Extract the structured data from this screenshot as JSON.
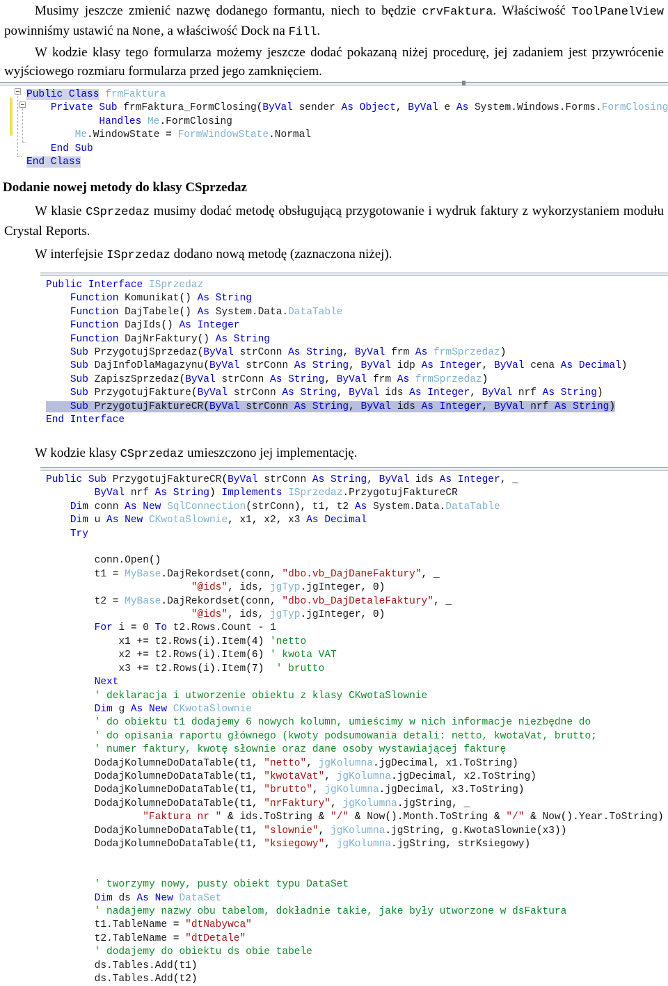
{
  "document": {
    "language": "pl",
    "colors": {
      "keyword": "#0000c8",
      "type": "#7fb2d0",
      "string": "#a31515",
      "comment": "#128a2c",
      "selection": "#b8bedd",
      "changebar": "#f0e050"
    }
  },
  "paragraphs": {
    "p1_part1": "Musimy jeszcze zmienić nazwę dodanego formantu, niech to będzie ",
    "p1_mono1": "crvFaktura",
    "p1_part2": ". Właściwość ",
    "p1_mono2": "ToolPanelView",
    "p1_part3": " powinniśmy ustawić na ",
    "p1_mono3": "None",
    "p1_part4": ", a właściwość Dock na ",
    "p1_mono4": "Fill",
    "p1_part5": ".",
    "p2": "W kodzie klasy tego formularza możemy jeszcze dodać pokazaną niżej procedurę, jej zadaniem jest przywrócenie wyjściowego rozmiaru formularza przed jego zamknięciem.",
    "heading1": "Dodanie nowej metody do klasy CSprzedaz",
    "p3_part1": "W klasie ",
    "p3_mono1": "CSprzedaz",
    "p3_part2": " musimy dodać metodę obsługującą przygotowanie i wydruk faktury z wykorzystaniem modułu Crystal Reports.",
    "p4_part1": "W interfejsie ",
    "p4_mono1": "ISprzedaz",
    "p4_part2": " dodano nową metodę (zaznaczona niżej).",
    "p5_part1": "W kodzie klasy ",
    "p5_mono1": "CSprzedaz",
    "p5_part2": " umieszczono jej implementację."
  },
  "code_block_1": {
    "name": "frmFaktura class code",
    "lines": [
      "Public Class frmFaktura",
      "    Private Sub frmFaktura_FormClosing(ByVal sender As Object, ByVal e As System.Windows.Forms.FormClosingEventArgs) _",
      "            Handles Me.FormClosing",
      "        Me.WindowState = FormWindowState.Normal",
      "    End Sub",
      "End Class"
    ]
  },
  "code_block_2": {
    "name": "ISprzedaz interface",
    "lines": [
      "Public Interface ISprzedaz",
      "    Function Komunikat() As String",
      "    Function DajTabele() As System.Data.DataTable",
      "    Function DajIds() As Integer",
      "    Function DajNrFaktury() As String",
      "    Sub PrzygotujSprzedaz(ByVal strConn As String, ByVal frm As frmSprzedaz)",
      "    Sub DajInfoDlaMagazynu(ByVal strConn As String, ByVal idp As Integer, ByVal cena As Decimal)",
      "    Sub ZapiszSprzedaz(ByVal strConn As String, ByVal frm As frmSprzedaz)",
      "    Sub PrzygotujFakture(ByVal strConn As String, ByVal ids As Integer, ByVal nrf As String)",
      "    Sub PrzygotujFaktureCR(ByVal strConn As String, ByVal ids As Integer, ByVal nrf As String)",
      "End Interface"
    ],
    "selected_line_index": 9
  },
  "code_block_3": {
    "name": "PrzygotujFaktureCR implementation",
    "lines": [
      "Public Sub PrzygotujFaktureCR(ByVal strConn As String, ByVal ids As Integer, _",
      "        ByVal nrf As String) Implements ISprzedaz.PrzygotujFaktureCR",
      "    Dim conn As New SqlConnection(strConn), t1, t2 As System.Data.DataTable",
      "    Dim u As New CKwotaSlownie, x1, x2, x3 As Decimal",
      "    Try",
      "        conn.Open()",
      "        t1 = MyBase.DajRekordset(conn, \"dbo.vb_DajDaneFaktury\", _",
      "                        \"@ids\", ids, jgTyp.jgInteger, 0)",
      "        t2 = MyBase.DajRekordset(conn, \"dbo.vb_DajDetaleFaktury\", _",
      "                        \"@ids\", ids, jgTyp.jgInteger, 0)",
      "        For i = 0 To t2.Rows.Count - 1",
      "            x1 += t2.Rows(i).Item(4) 'netto",
      "            x2 += t2.Rows(i).Item(6) ' kwota VAT",
      "            x3 += t2.Rows(i).Item(7)  ' brutto",
      "        Next",
      "        ' deklaracja i utworzenie obiektu z klasy CKwotaSlownie",
      "        Dim g As New CKwotaSlownie",
      "        ' do obiektu t1 dodajemy 6 nowych kolumn, umieścimy w nich informacje niezbędne do",
      "        ' do opisania raportu głównego (kwoty podsumowania detali: netto, kwotaVat, brutto;",
      "        ' numer faktury, kwotę słownie oraz dane osoby wystawiającej fakturę",
      "        DodajKolumneDoDataTable(t1, \"netto\", jgKolumna.jgDecimal, x1.ToString)",
      "        DodajKolumneDoDataTable(t1, \"kwotaVat\", jgKolumna.jgDecimal, x2.ToString)",
      "        DodajKolumneDoDataTable(t1, \"brutto\", jgKolumna.jgDecimal, x3.ToString)",
      "        DodajKolumneDoDataTable(t1, \"nrFaktury\", jgKolumna.jgString, _",
      "                \"Faktura nr \" & ids.ToString & \"/\" & Now().Month.ToString & \"/\" & Now().Year.ToString)",
      "        DodajKolumneDoDataTable(t1, \"slownie\", jgKolumna.jgString, g.KwotaSlownie(x3))",
      "        DodajKolumneDoDataTable(t1, \"ksiegowy\", jgKolumna.jgString, strKsiegowy)",
      "",
      "        ' tworzymy nowy, pusty obiekt typu DataSet",
      "        Dim ds As New DataSet",
      "        ' nadajemy nazwy obu tabelom, dokładnie takie, jake były utworzone w dsFaktura",
      "        t1.TableName = \"dtNabywca\"",
      "        t2.TableName = \"dtDetale\"",
      "        ' dodajemy do obiektu ds obie tabele",
      "        ds.Tables.Add(t1)",
      "        ds.Tables.Add(t2)"
    ]
  }
}
